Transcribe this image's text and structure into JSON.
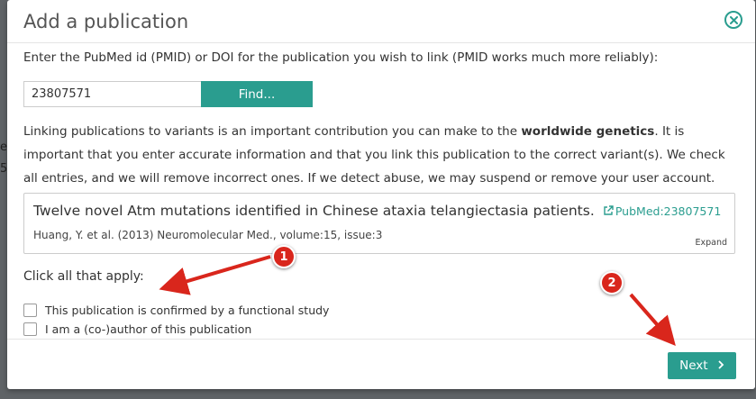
{
  "background": {
    "fragments": [
      "e",
      "5"
    ]
  },
  "modal": {
    "title": "Add a publication",
    "instruction": "Enter the PubMed id (PMID) or DOI for the publication you wish to link (PMID works much more reliably):",
    "search": {
      "value": "23807571",
      "find_label": "Find..."
    },
    "warning": {
      "part1": "Linking publications to variants is an important contribution you can make to the ",
      "bold": "worldwide genetics",
      "part2": ". It is important that you enter accurate information and that you link this publication to the correct variant(s). We check all entries, and we will remove incorrect ones. If we detect abuse, we may suspend or remove your user account."
    },
    "publication": {
      "title": "Twelve novel Atm mutations identified in Chinese ataxia telangiectasia patients.",
      "pubmed_link": "PubMed:23807571",
      "meta": "Huang, Y. et al. (2013) Neuromolecular Med., volume:15, issue:3",
      "expand_label": "Expand"
    },
    "click_all_label": "Click all that apply:",
    "checkboxes": [
      {
        "label": "This publication is confirmed by a functional study",
        "checked": false
      },
      {
        "label": "I am a (co-)author of this publication",
        "checked": false
      }
    ],
    "next_label": "Next"
  },
  "annotations": {
    "badge1": "1",
    "badge2": "2"
  },
  "colors": {
    "accent": "#2a9d8f",
    "annotation": "#d9261c"
  },
  "icons": {
    "close": "close-circle-icon",
    "external_link": "external-link-icon",
    "next": "chevron-right-icon"
  }
}
